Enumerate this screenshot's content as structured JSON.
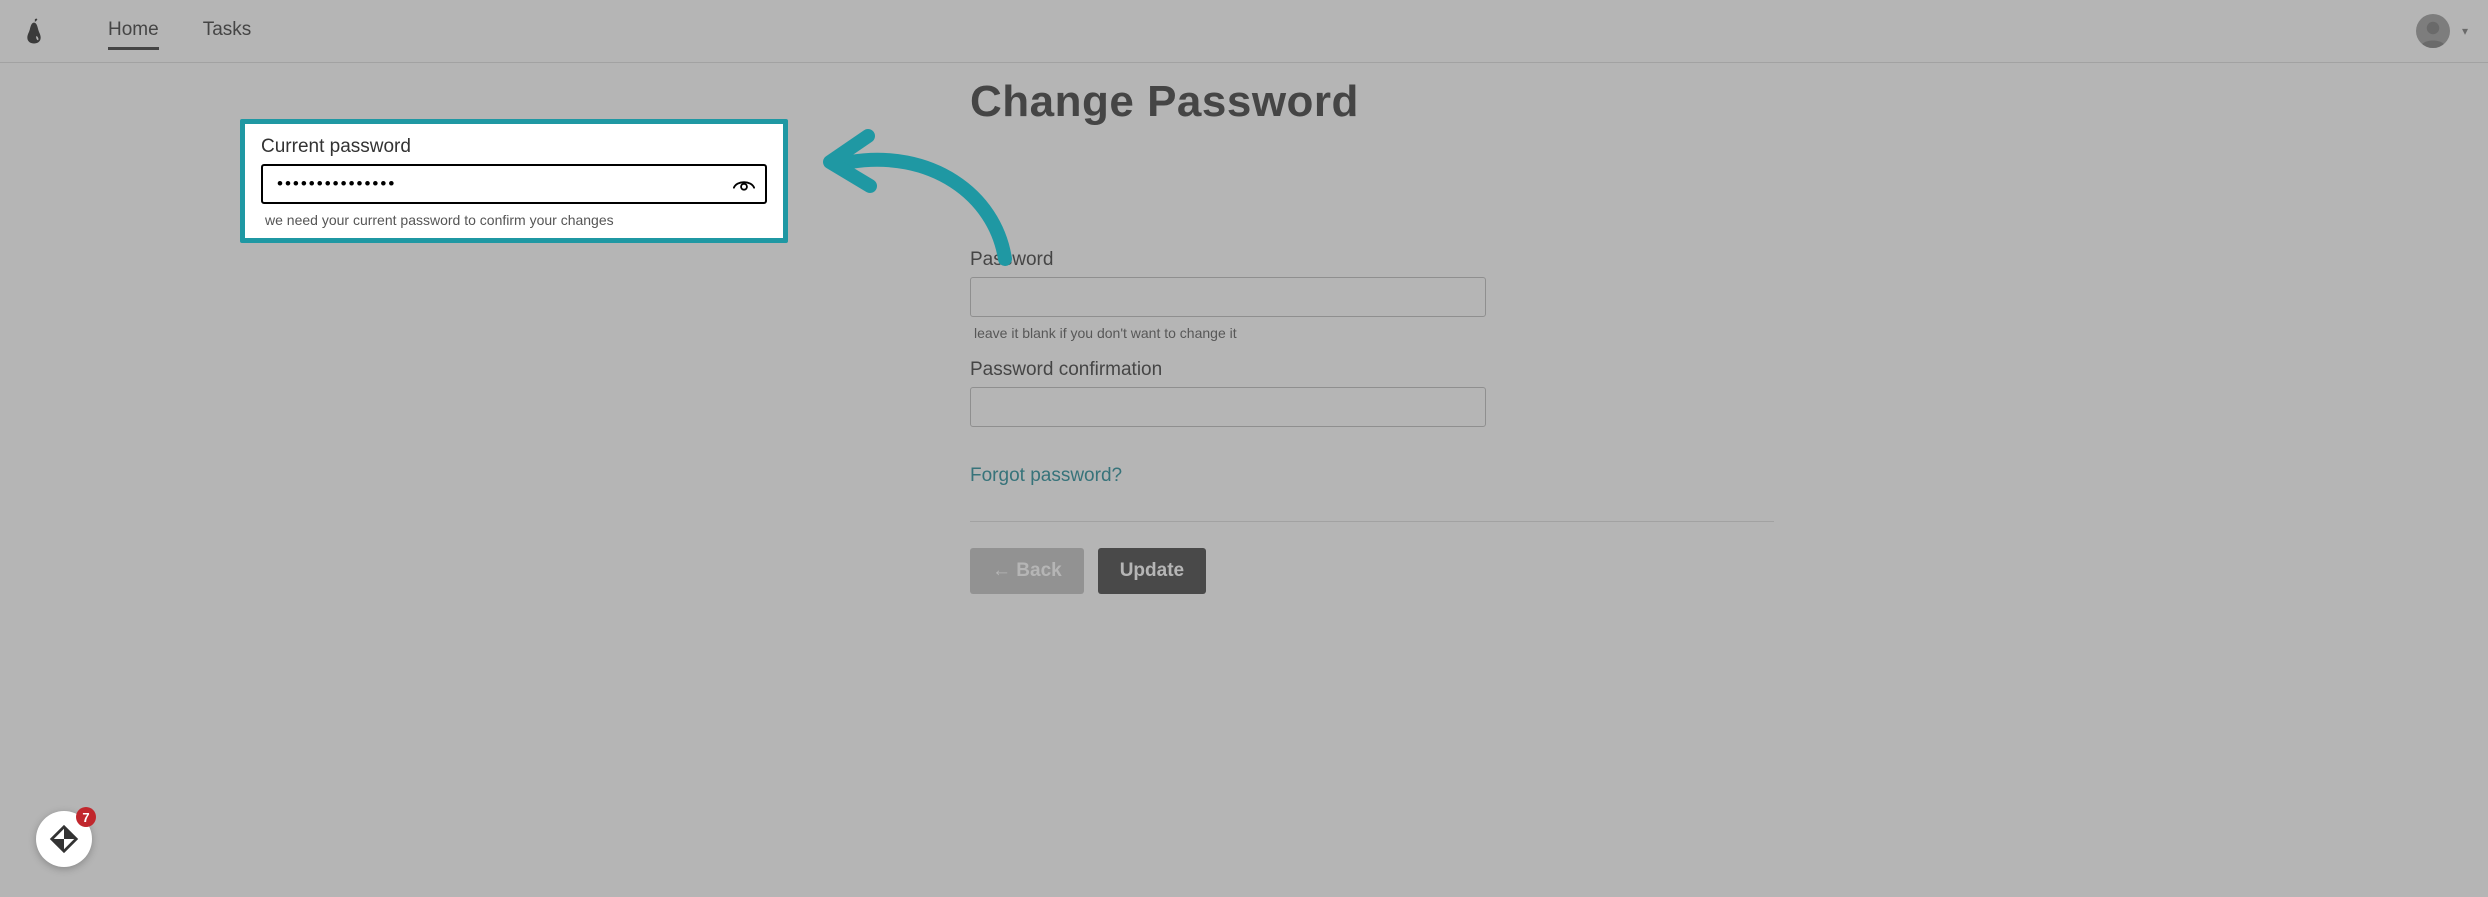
{
  "nav": {
    "links": [
      {
        "label": "Home",
        "active": true
      },
      {
        "label": "Tasks",
        "active": false
      }
    ]
  },
  "page": {
    "title": "Change Password"
  },
  "fields": {
    "current_password": {
      "label": "Current password",
      "value": "•••••••••••••••",
      "helper": "we need your current password to confirm your changes"
    },
    "password": {
      "label": "Password",
      "value": "",
      "helper": "leave it blank if you don't want to change it"
    },
    "password_confirmation": {
      "label": "Password confirmation",
      "value": ""
    }
  },
  "links": {
    "forgot": "Forgot password?"
  },
  "buttons": {
    "back": "←  Back",
    "update": "Update"
  },
  "widget": {
    "badge_count": "7"
  },
  "colors": {
    "accent": "#1f98a3"
  }
}
